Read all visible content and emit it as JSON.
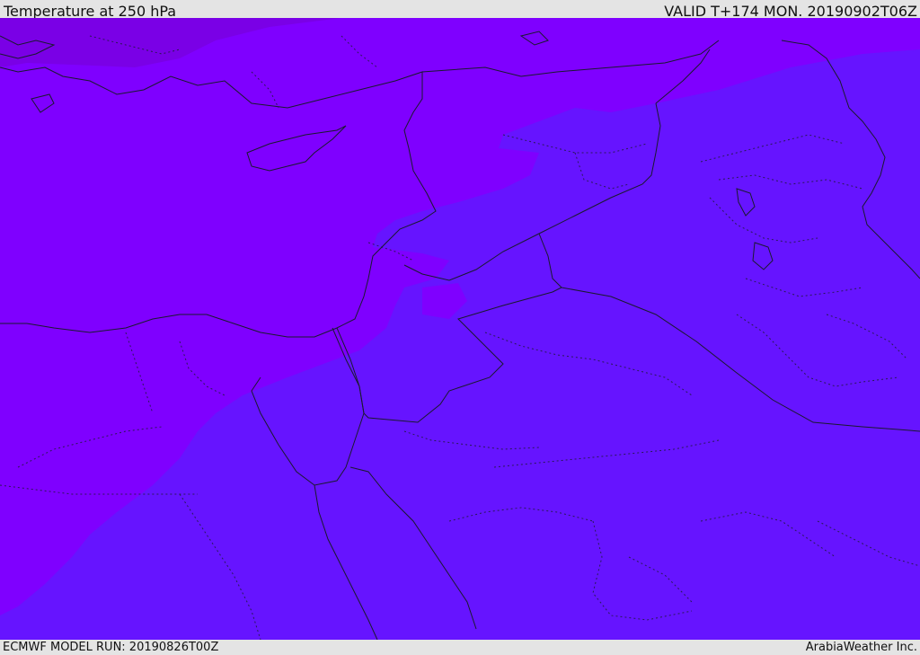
{
  "header": {
    "title": "Temperature at 250 hPa",
    "valid_time": "VALID T+174 MON. 20190902T06Z"
  },
  "footer": {
    "model_run": "ECMWF MODEL RUN: 20190826T00Z",
    "credit": "ArabiaWeather Inc."
  },
  "map": {
    "colors": {
      "warm_band": "#7f00ff",
      "cold_band": "#6614ff",
      "far_north_band": "#7a00e6",
      "border_line": "#1a1a2e"
    }
  }
}
